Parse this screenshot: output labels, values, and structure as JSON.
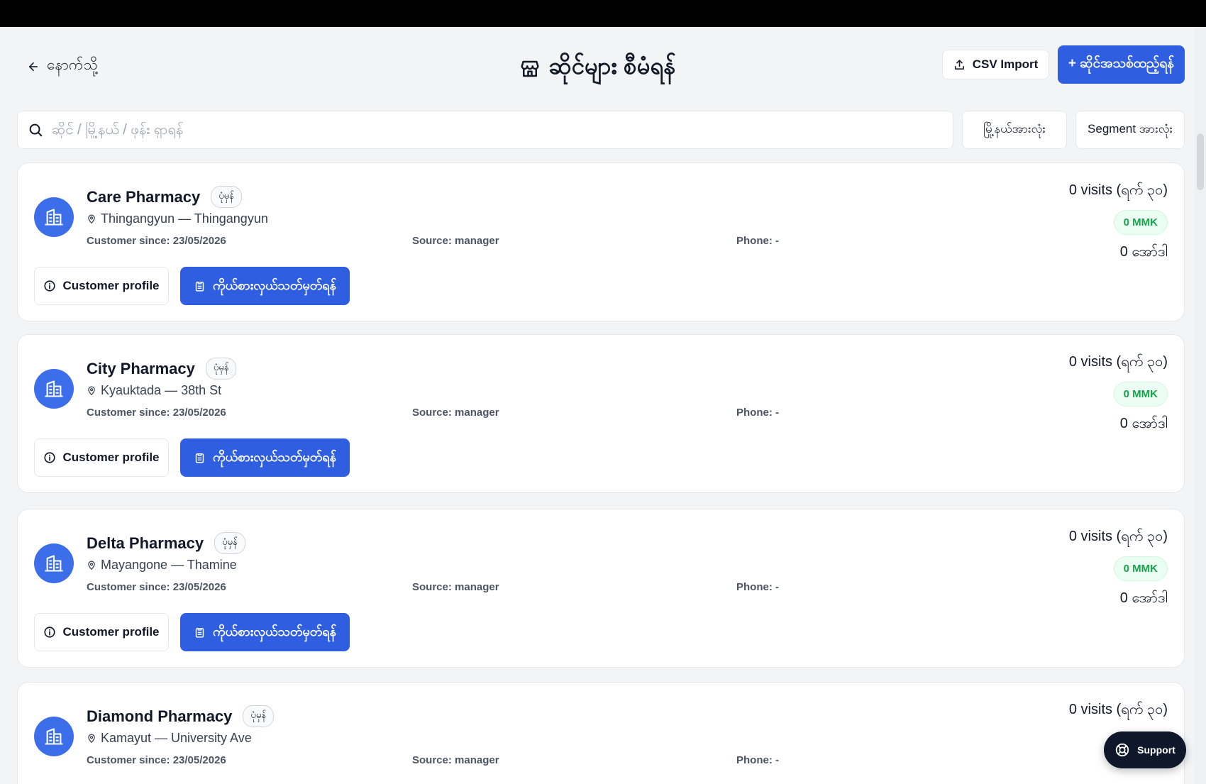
{
  "header": {
    "back_label": "နောက်သို့",
    "title": "ဆိုင်များ စီမံရန်",
    "csv_label": "CSV Import",
    "add_label": "+ ဆိုင်အသစ်ထည့်ရန်"
  },
  "search": {
    "placeholder": "ဆိုင် / မြို့နယ် / ဖုန်း ရှာရန်",
    "value": ""
  },
  "filters": {
    "city": "မြို့နယ်အားလုံး",
    "segment": "Segment အားလုံး"
  },
  "stores": [
    {
      "name": "Care Pharmacy",
      "tag": "ပုံမှန်",
      "location": "Thingangyun — Thingangyun",
      "since": "Customer since: 23/05/2026",
      "source": "Source: manager",
      "phone": "Phone: -",
      "visits": "0 visits (ရက် ၃၀)",
      "amount": "0 MMK",
      "orders": "0 အော်ဒါ",
      "profile_label": "Customer profile",
      "visit_label": "ကိုယ်စားလှယ်သတ်မှတ်ရန်"
    },
    {
      "name": "City Pharmacy",
      "tag": "ပုံမှန်",
      "location": "Kyauktada — 38th St",
      "since": "Customer since: 23/05/2026",
      "source": "Source: manager",
      "phone": "Phone: -",
      "visits": "0 visits (ရက် ၃၀)",
      "amount": "0 MMK",
      "orders": "0 အော်ဒါ",
      "profile_label": "Customer profile",
      "visit_label": "ကိုယ်စားလှယ်သတ်မှတ်ရန်"
    },
    {
      "name": "Delta Pharmacy",
      "tag": "ပုံမှန်",
      "location": "Mayangone — Thamine",
      "since": "Customer since: 23/05/2026",
      "source": "Source: manager",
      "phone": "Phone: -",
      "visits": "0 visits (ရက် ၃၀)",
      "amount": "0 MMK",
      "orders": "0 အော်ဒါ",
      "profile_label": "Customer profile",
      "visit_label": "ကိုယ်စားလှယ်သတ်မှတ်ရန်"
    },
    {
      "name": "Diamond Pharmacy",
      "tag": "ပုံမှန်",
      "location": "Kamayut — University Ave",
      "since": "Customer since: 23/05/2026",
      "source": "Source: manager",
      "phone": "Phone: -",
      "visits": "0 visits (ရက် ၃၀)"
    }
  ],
  "support_label": "Support",
  "colors": {
    "primary": "#2f5fe0",
    "avatar": "#3b6ee8",
    "success": "#16a34a",
    "background": "#f3f4f6"
  },
  "icons": {
    "back": "arrow-left-icon",
    "title": "store-icon",
    "csv": "upload-icon",
    "search": "search-icon",
    "avatar": "building-icon",
    "location": "map-pin-icon",
    "profile": "info-icon",
    "visit": "clipboard-icon",
    "support": "lifebuoy-icon"
  }
}
